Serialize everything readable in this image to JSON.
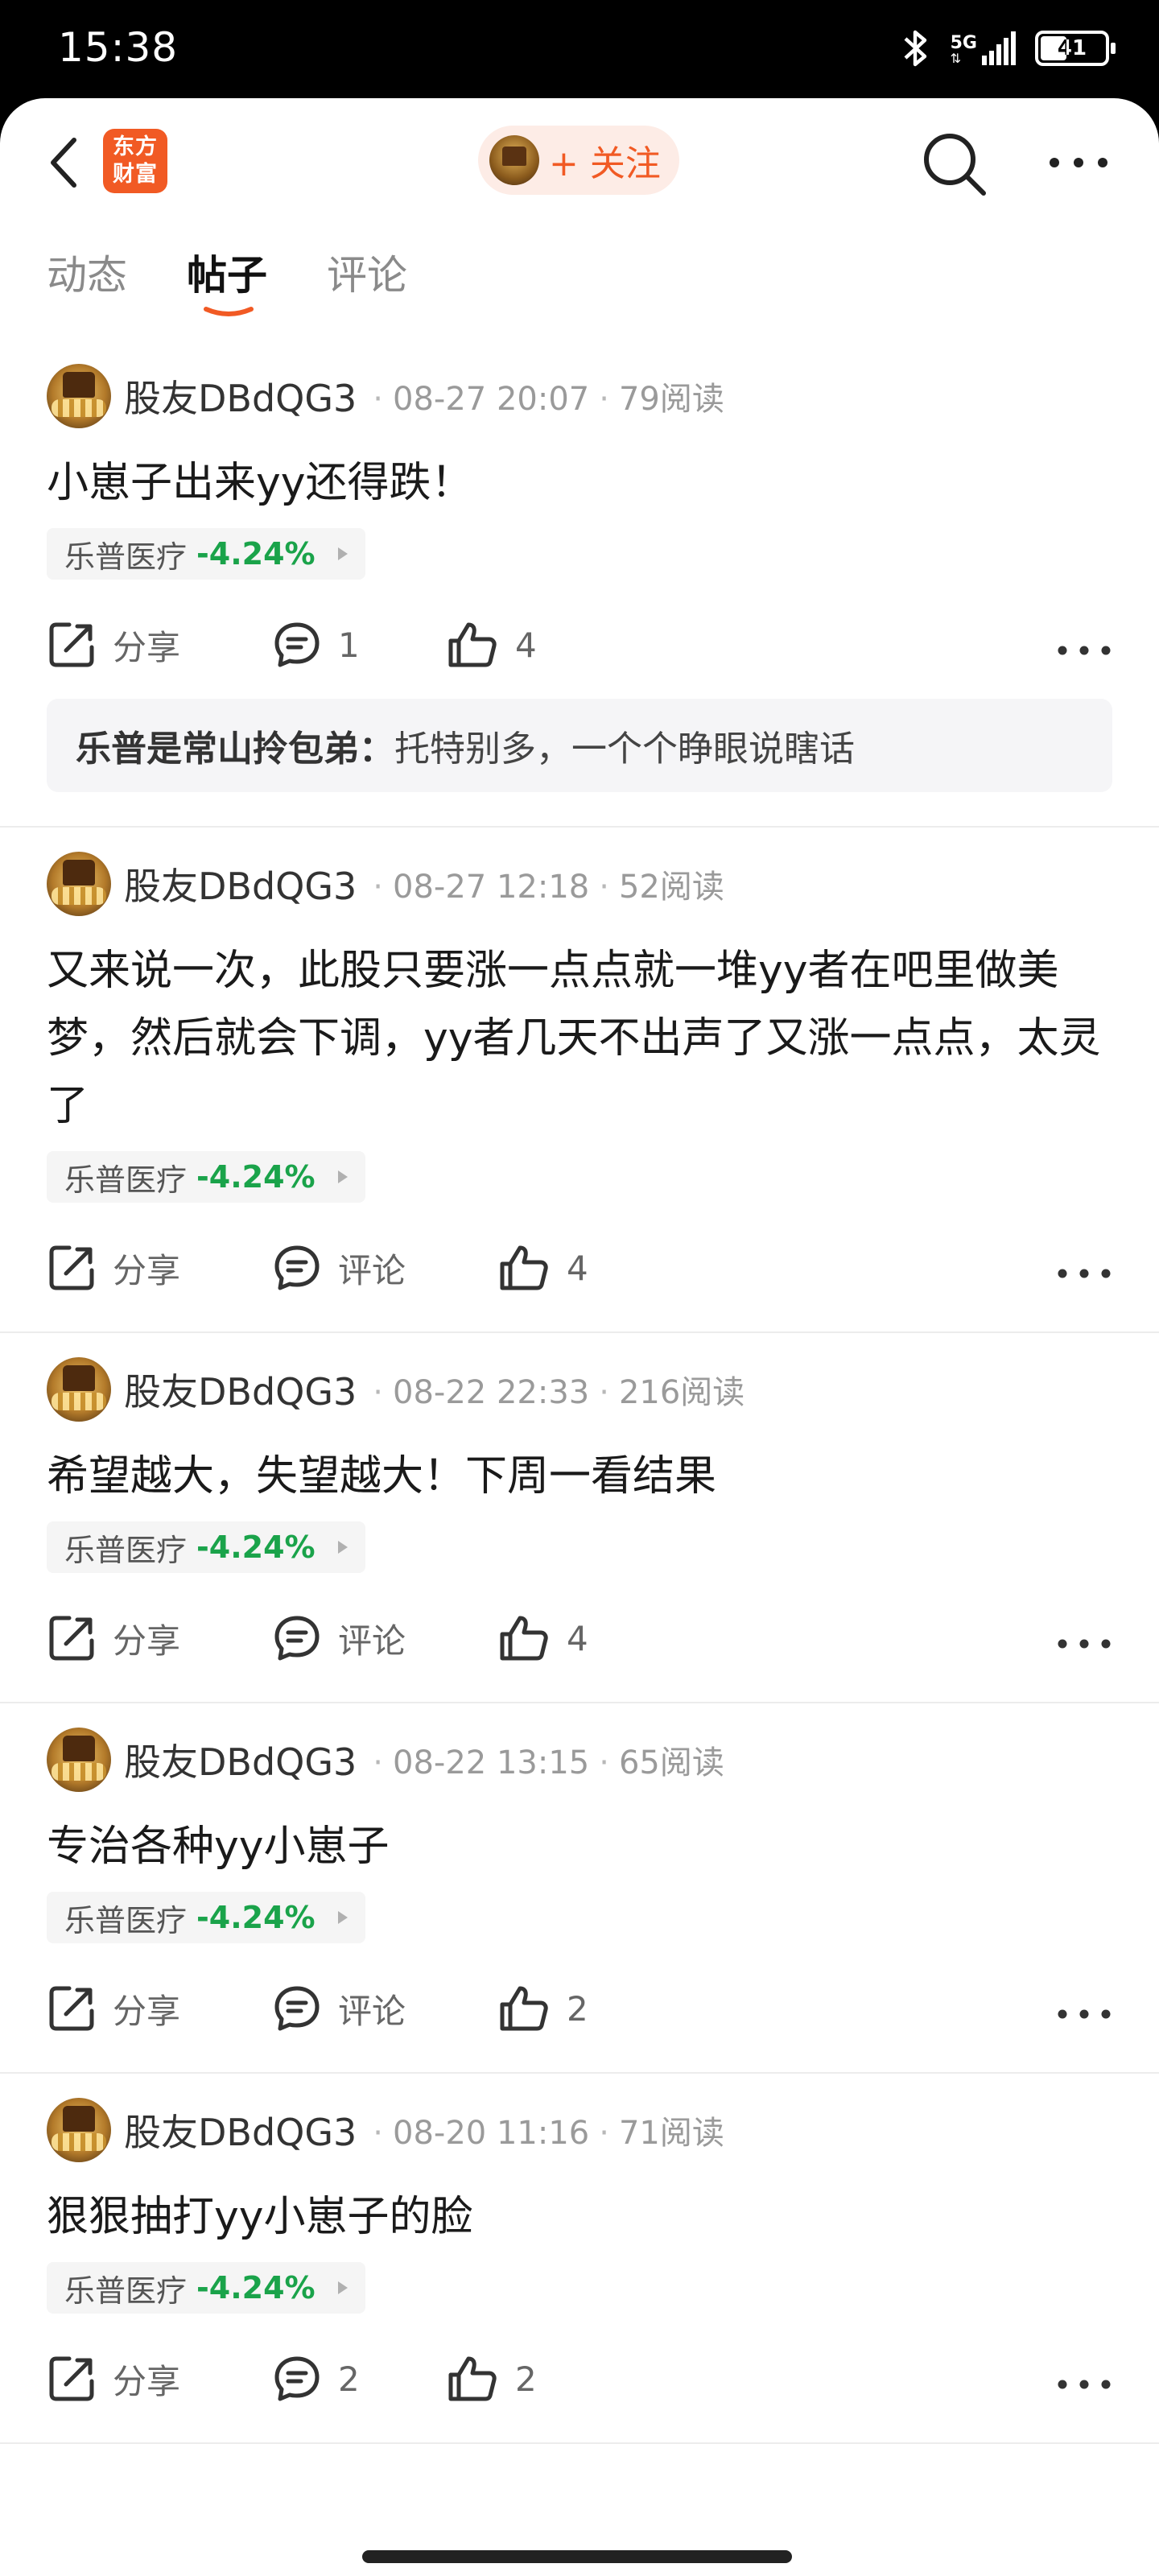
{
  "status": {
    "time": "15:38",
    "network": "5G",
    "battery": "41"
  },
  "header": {
    "logo_line1": "东方",
    "logo_line2": "财富",
    "follow_label": "+ 关注"
  },
  "tabs": [
    {
      "label": "动态",
      "active": false
    },
    {
      "label": "帖子",
      "active": true
    },
    {
      "label": "评论",
      "active": false
    }
  ],
  "colors": {
    "accent": "#f15a24",
    "stock_down": "#1aa34a"
  },
  "posts": [
    {
      "username": "股友DBdQG3",
      "time": "08-27 20:07",
      "reads": "79阅读",
      "text": "小崽子出来yy还得跌！",
      "stock": {
        "name": "乐普医疗",
        "change": "-4.24%"
      },
      "share_label": "分享",
      "comment_label": "1",
      "like_label": "4",
      "comment_preview": {
        "author": "乐普是常山拎包弟：",
        "text": "托特别多，一个个睁眼说瞎话"
      }
    },
    {
      "username": "股友DBdQG3",
      "time": "08-27 12:18",
      "reads": "52阅读",
      "text": "又来说一次，此股只要涨一点点就一堆yy者在吧里做美梦，然后就会下调，yy者几天不出声了又涨一点点，太灵了",
      "stock": {
        "name": "乐普医疗",
        "change": "-4.24%"
      },
      "share_label": "分享",
      "comment_label": "评论",
      "like_label": "4"
    },
    {
      "username": "股友DBdQG3",
      "time": "08-22 22:33",
      "reads": "216阅读",
      "text": "希望越大，失望越大！下周一看结果",
      "stock": {
        "name": "乐普医疗",
        "change": "-4.24%"
      },
      "share_label": "分享",
      "comment_label": "评论",
      "like_label": "4"
    },
    {
      "username": "股友DBdQG3",
      "time": "08-22 13:15",
      "reads": "65阅读",
      "text": "专治各种yy小崽子",
      "stock": {
        "name": "乐普医疗",
        "change": "-4.24%"
      },
      "share_label": "分享",
      "comment_label": "评论",
      "like_label": "2"
    },
    {
      "username": "股友DBdQG3",
      "time": "08-20 11:16",
      "reads": "71阅读",
      "text": "狠狠抽打yy小崽子的脸",
      "stock": {
        "name": "乐普医疗",
        "change": "-4.24%"
      },
      "share_label": "分享",
      "comment_label": "2",
      "like_label": "2"
    }
  ]
}
